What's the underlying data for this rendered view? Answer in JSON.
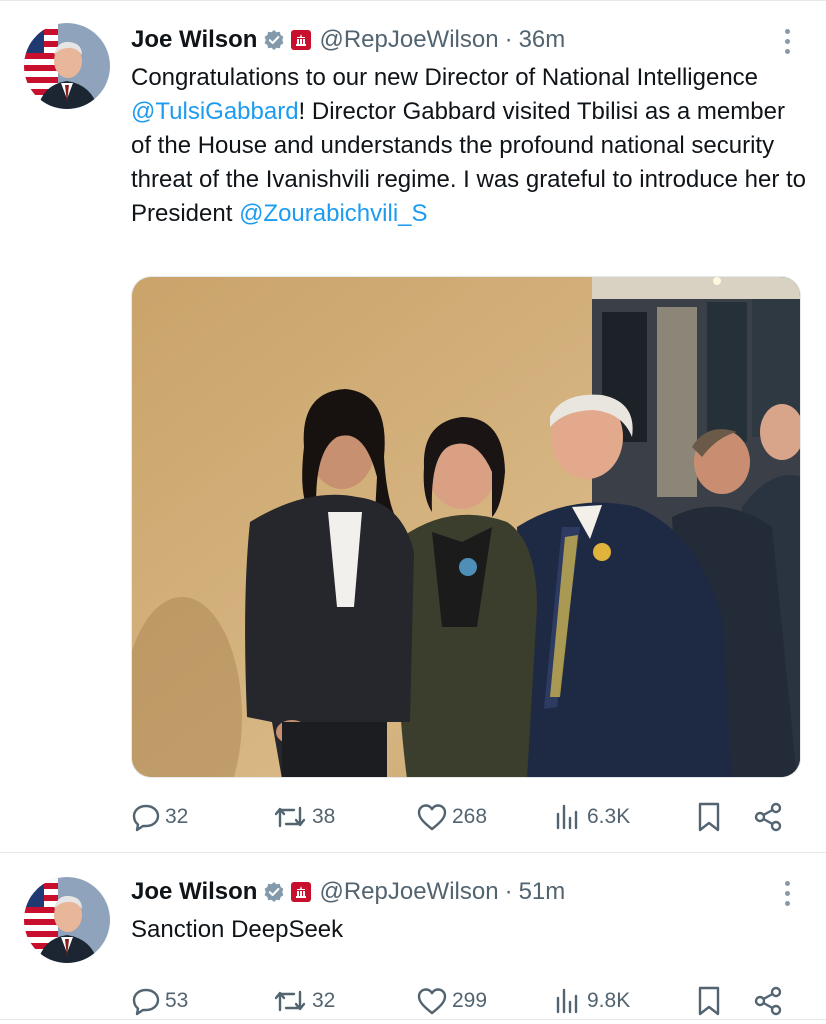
{
  "colors": {
    "text": "#0f1419",
    "muted": "#536471",
    "link": "#1d9bf0",
    "divider": "#e6e9ec"
  },
  "tweets": [
    {
      "author": {
        "name": "Joe Wilson",
        "handle": "@RepJoeWilson",
        "verified_icon": "verified-badge-icon",
        "affiliation_icon": "house-seal-icon"
      },
      "time": "36m",
      "text": {
        "p1": "Congratulations to our new Director of National Intelligence ",
        "m1": "@TulsiGabbard",
        "p2": "! Director Gabbard visited Tbilisi as a member of the House and understands the profound national security threat of the Ivanishvili regime. I was grateful to introduce her to President ",
        "m2": "@Zourabichvili_S"
      },
      "has_photo": true,
      "stats": {
        "replies": "32",
        "reposts": "38",
        "likes": "268",
        "views": "6.3K"
      }
    },
    {
      "author": {
        "name": "Joe Wilson",
        "handle": "@RepJoeWilson",
        "verified_icon": "verified-badge-icon",
        "affiliation_icon": "house-seal-icon"
      },
      "time": "51m",
      "text": {
        "p1": "Sanction DeepSeek"
      },
      "has_photo": false,
      "stats": {
        "replies": "53",
        "reposts": "32",
        "likes": "299",
        "views": "9.8K"
      }
    }
  ]
}
